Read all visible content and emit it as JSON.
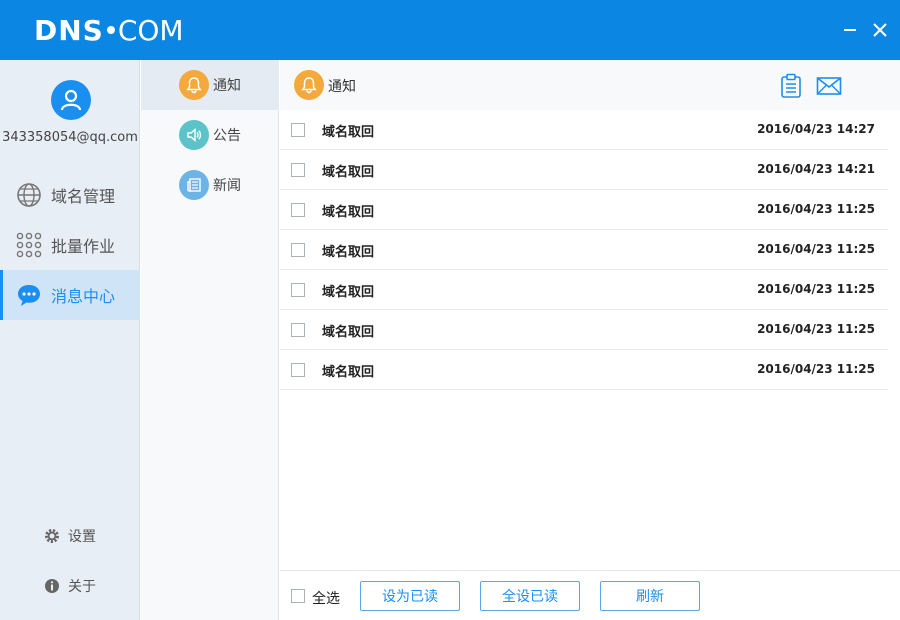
{
  "app": {
    "logo_bold": "DNS",
    "logo_thin": "COM"
  },
  "window": {
    "minimize": "—",
    "close": "✕"
  },
  "user": {
    "email": "343358054@qq.com"
  },
  "leftnav": {
    "items": [
      {
        "label": "域名管理",
        "icon": "globe-icon"
      },
      {
        "label": "批量作业",
        "icon": "grid-dots-icon"
      },
      {
        "label": "消息中心",
        "icon": "chat-bubble-icon",
        "active": true
      }
    ],
    "settings": "设置",
    "about": "关于"
  },
  "subnav": {
    "items": [
      {
        "label": "通知",
        "icon": "bell-icon",
        "color": "#f3a93b",
        "active": true
      },
      {
        "label": "公告",
        "icon": "speaker-icon",
        "color": "#5cc4c8"
      },
      {
        "label": "新闻",
        "icon": "newspaper-icon",
        "color": "#6cb3e6"
      }
    ]
  },
  "main": {
    "title": "通知",
    "messages": [
      {
        "subject": "域名取回",
        "time": "2016/04/23 14:27"
      },
      {
        "subject": "域名取回",
        "time": "2016/04/23 14:21"
      },
      {
        "subject": "域名取回",
        "time": "2016/04/23 11:25"
      },
      {
        "subject": "域名取回",
        "time": "2016/04/23 11:25"
      },
      {
        "subject": "域名取回",
        "time": "2016/04/23 11:25"
      },
      {
        "subject": "域名取回",
        "time": "2016/04/23 11:25"
      },
      {
        "subject": "域名取回",
        "time": "2016/04/23 11:25"
      }
    ]
  },
  "footer": {
    "select_all": "全选",
    "mark_read": "设为已读",
    "mark_all_read": "全设已读",
    "refresh": "刷新"
  },
  "colors": {
    "brand": "#0b86e3",
    "accent": "#1b8ff0"
  }
}
